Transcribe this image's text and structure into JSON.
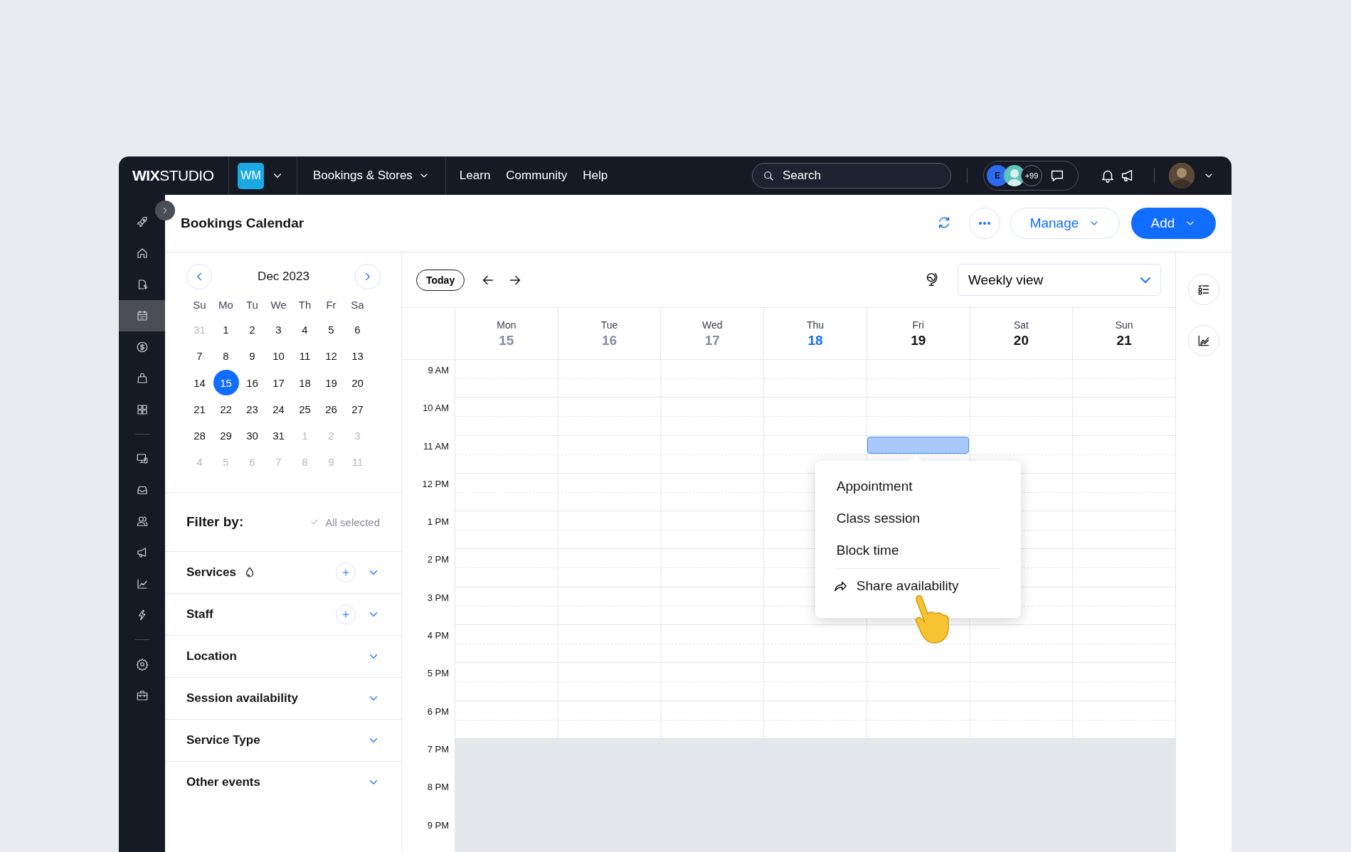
{
  "topbar": {
    "logo": "**WIX**STUDIO",
    "site_badge": "WM",
    "nav": [
      {
        "label": "Bookings & Stores",
        "kind": "dropdown"
      },
      {
        "label": "Learn",
        "kind": "link"
      },
      {
        "label": "Community",
        "kind": "link"
      },
      {
        "label": "Help",
        "kind": "link"
      }
    ],
    "search": {
      "placeholder": "Search"
    },
    "collaborators": [
      {
        "kind": "initial",
        "initial": "E",
        "color": "#2f6bf2"
      },
      {
        "kind": "avatar",
        "color": "#5fc3b8"
      }
    ],
    "collaborators_more": "+99"
  },
  "sidebar": {
    "groups": [
      {
        "items": [
          {
            "selected": false
          },
          {
            "selected": false
          },
          {
            "selected": false
          },
          {
            "selected": true
          },
          {
            "selected": false
          },
          {
            "selected": false
          },
          {
            "selected": false
          }
        ]
      },
      {
        "items": [
          {
            "selected": false
          },
          {
            "selected": false
          },
          {
            "selected": false
          },
          {
            "selected": false
          },
          {
            "selected": false
          },
          {
            "selected": false
          }
        ]
      },
      {
        "items": [
          {
            "selected": false
          },
          {
            "selected": false
          }
        ]
      }
    ]
  },
  "header": {
    "title": "Bookings Calendar",
    "manage": "Manage",
    "add": "Add"
  },
  "mini_calendar": {
    "month": "Dec 2023",
    "weekdays": [
      "Su",
      "Mo",
      "Tu",
      "We",
      "Th",
      "Fr",
      "Sa"
    ],
    "weeks": [
      [
        {
          "day": "31",
          "outside": true,
          "selected": false
        },
        {
          "day": "1",
          "outside": false,
          "selected": false
        },
        {
          "day": "2",
          "outside": false,
          "selected": false
        },
        {
          "day": "3",
          "outside": false,
          "selected": false
        },
        {
          "day": "4",
          "outside": false,
          "selected": false
        },
        {
          "day": "5",
          "outside": false,
          "selected": false
        },
        {
          "day": "6",
          "outside": false,
          "selected": false
        }
      ],
      [
        {
          "day": "7",
          "outside": false,
          "selected": false
        },
        {
          "day": "8",
          "outside": false,
          "selected": false
        },
        {
          "day": "9",
          "outside": false,
          "selected": false
        },
        {
          "day": "10",
          "outside": false,
          "selected": false
        },
        {
          "day": "11",
          "outside": false,
          "selected": false
        },
        {
          "day": "12",
          "outside": false,
          "selected": false
        },
        {
          "day": "13",
          "outside": false,
          "selected": false
        }
      ],
      [
        {
          "day": "14",
          "outside": false,
          "selected": false
        },
        {
          "day": "15",
          "outside": false,
          "selected": true
        },
        {
          "day": "16",
          "outside": false,
          "selected": false
        },
        {
          "day": "17",
          "outside": false,
          "selected": false
        },
        {
          "day": "18",
          "outside": false,
          "selected": false
        },
        {
          "day": "19",
          "outside": false,
          "selected": false
        },
        {
          "day": "20",
          "outside": false,
          "selected": false
        }
      ],
      [
        {
          "day": "21",
          "outside": false,
          "selected": false
        },
        {
          "day": "22",
          "outside": false,
          "selected": false
        },
        {
          "day": "23",
          "outside": false,
          "selected": false
        },
        {
          "day": "24",
          "outside": false,
          "selected": false
        },
        {
          "day": "25",
          "outside": false,
          "selected": false
        },
        {
          "day": "26",
          "outside": false,
          "selected": false
        },
        {
          "day": "27",
          "outside": false,
          "selected": false
        }
      ],
      [
        {
          "day": "28",
          "outside": false,
          "selected": false
        },
        {
          "day": "29",
          "outside": false,
          "selected": false
        },
        {
          "day": "30",
          "outside": false,
          "selected": false
        },
        {
          "day": "31",
          "outside": false,
          "selected": false
        },
        {
          "day": "1",
          "outside": true,
          "selected": false
        },
        {
          "day": "2",
          "outside": true,
          "selected": false
        },
        {
          "day": "3",
          "outside": true,
          "selected": false
        }
      ],
      [
        {
          "day": "4",
          "outside": true,
          "selected": false
        },
        {
          "day": "5",
          "outside": true,
          "selected": false
        },
        {
          "day": "6",
          "outside": true,
          "selected": false
        },
        {
          "day": "7",
          "outside": true,
          "selected": false
        },
        {
          "day": "8",
          "outside": true,
          "selected": false
        },
        {
          "day": "9",
          "outside": true,
          "selected": false
        },
        {
          "day": "11",
          "outside": true,
          "selected": false
        }
      ]
    ]
  },
  "filter": {
    "title": "Filter by:",
    "status": "All selected",
    "sections": [
      {
        "label": "Services",
        "info": true,
        "addable": true
      },
      {
        "label": "Staff",
        "info": false,
        "addable": true
      },
      {
        "label": "Location",
        "info": false,
        "addable": false
      },
      {
        "label": "Session availability",
        "info": false,
        "addable": false
      },
      {
        "label": "Service Type",
        "info": false,
        "addable": false
      },
      {
        "label": "Other events",
        "info": false,
        "addable": false
      }
    ]
  },
  "calendar": {
    "today_button": "Today",
    "view": "Weekly view",
    "days": [
      {
        "weekday": "Mon",
        "date": "15",
        "past": true,
        "today": false,
        "slot_selected": false
      },
      {
        "weekday": "Tue",
        "date": "16",
        "past": true,
        "today": false,
        "slot_selected": false
      },
      {
        "weekday": "Wed",
        "date": "17",
        "past": true,
        "today": false,
        "slot_selected": false
      },
      {
        "weekday": "Thu",
        "date": "18",
        "past": false,
        "today": true,
        "slot_selected": false
      },
      {
        "weekday": "Fri",
        "date": "19",
        "past": false,
        "today": false,
        "slot_selected": true
      },
      {
        "weekday": "Sat",
        "date": "20",
        "past": false,
        "today": false,
        "slot_selected": false
      },
      {
        "weekday": "Sun",
        "date": "21",
        "past": false,
        "today": false,
        "slot_selected": false
      }
    ],
    "hours": [
      {
        "label": "9 AM",
        "off_hours": false,
        "slot_selected": false
      },
      {
        "label": "10 AM",
        "off_hours": false,
        "slot_selected": false
      },
      {
        "label": "11 AM",
        "off_hours": false,
        "slot_selected": true
      },
      {
        "label": "12 PM",
        "off_hours": false,
        "slot_selected": false
      },
      {
        "label": "1 PM",
        "off_hours": false,
        "slot_selected": false
      },
      {
        "label": "2 PM",
        "off_hours": false,
        "slot_selected": false
      },
      {
        "label": "3 PM",
        "off_hours": false,
        "slot_selected": false
      },
      {
        "label": "4 PM",
        "off_hours": false,
        "slot_selected": false
      },
      {
        "label": "5 PM",
        "off_hours": false,
        "slot_selected": false
      },
      {
        "label": "6 PM",
        "off_hours": false,
        "slot_selected": false
      },
      {
        "label": "7 PM",
        "off_hours": true,
        "slot_selected": false
      },
      {
        "label": "8 PM",
        "off_hours": true,
        "slot_selected": false
      },
      {
        "label": "9 PM",
        "off_hours": true,
        "slot_selected": false
      }
    ],
    "menu": [
      {
        "label": "Appointment",
        "kind": "option"
      },
      {
        "label": "Class session",
        "kind": "option"
      },
      {
        "label": "Block time",
        "kind": "option"
      },
      {
        "label": "Share availability",
        "kind": "share"
      }
    ]
  }
}
